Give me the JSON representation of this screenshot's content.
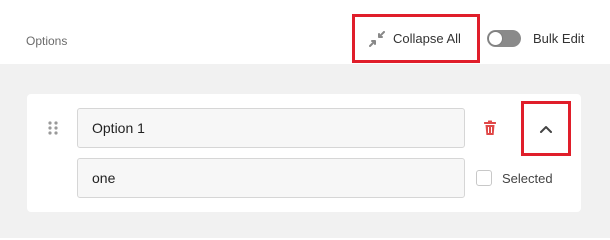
{
  "header": {
    "title": "Options",
    "collapse_all_label": "Collapse All",
    "collapse_icon": "compress-arrows-icon",
    "bulk_edit_label": "Bulk Edit",
    "bulk_edit_on": false
  },
  "options": [
    {
      "label": "Option 1",
      "value": "one",
      "selected": false,
      "selected_label": "Selected",
      "expanded": true
    }
  ],
  "colors": {
    "highlight": "#e01e2a",
    "delete": "#e04848",
    "background": "#f1f1f1"
  }
}
